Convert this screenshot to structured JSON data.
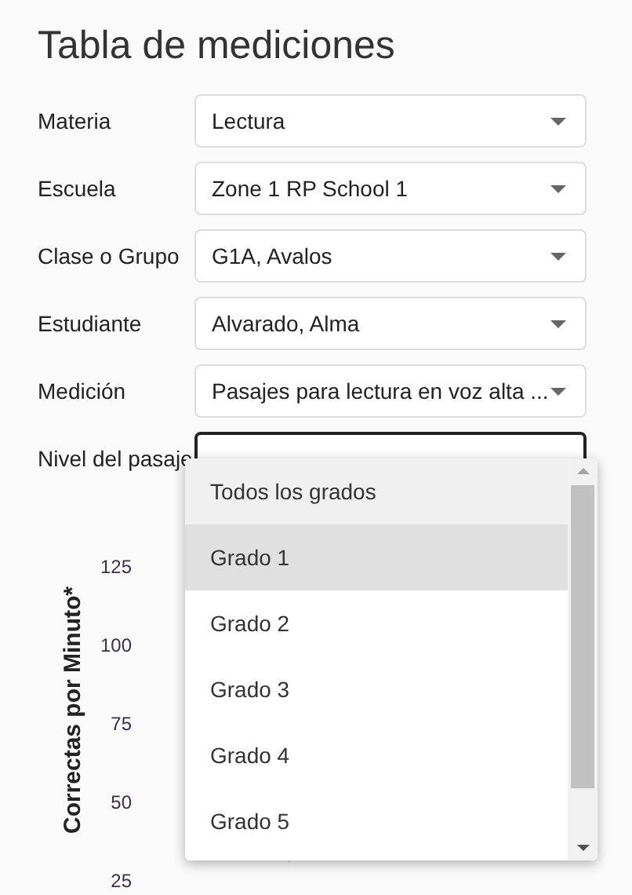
{
  "title": "Tabla de mediciones",
  "fields": [
    {
      "label": "Materia",
      "value": "Lectura",
      "open": false
    },
    {
      "label": "Escuela",
      "value": "Zone 1 RP School 1",
      "open": false
    },
    {
      "label": "Clase o Grupo",
      "value": "G1A, Avalos",
      "open": false
    },
    {
      "label": "Estudiante",
      "value": "Alvarado, Alma",
      "open": false
    },
    {
      "label": "Medición",
      "value": "Pasajes para lectura en voz alta ...",
      "open": false
    },
    {
      "label": "Nivel del pasaje",
      "open": true
    }
  ],
  "menu": {
    "items": [
      {
        "label": "Todos los grados",
        "selected": false,
        "hovered": true
      },
      {
        "label": "Grado 1",
        "selected": true,
        "hovered": false
      },
      {
        "label": "Grado 2",
        "selected": false,
        "hovered": false
      },
      {
        "label": "Grado 3",
        "selected": false,
        "hovered": false
      },
      {
        "label": "Grado 4",
        "selected": false,
        "hovered": false
      },
      {
        "label": "Grado 5",
        "selected": false,
        "hovered": false
      }
    ]
  },
  "chart": {
    "ylabel": "Correctas por Minuto*",
    "yticks": [
      "125",
      "100",
      "75",
      "50",
      "25"
    ]
  }
}
